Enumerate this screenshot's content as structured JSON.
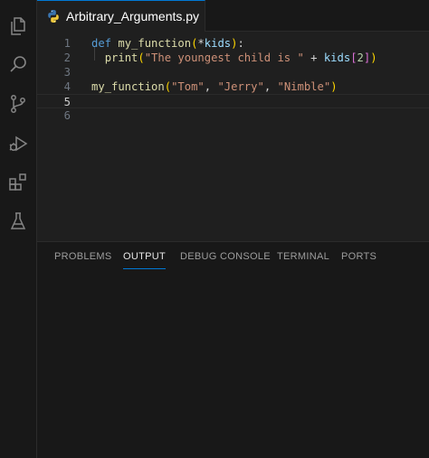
{
  "tab": {
    "filename": "Arbitrary_Arguments.py"
  },
  "activity_bar": [
    "explorer-icon",
    "search-icon",
    "source-control-icon",
    "run-debug-icon",
    "extensions-icon",
    "testing-icon"
  ],
  "editor": {
    "current_line": 5,
    "lines": [
      {
        "number": "1",
        "tokens": [
          {
            "t": "def",
            "c": "kw"
          },
          {
            "t": " ",
            "c": "op"
          },
          {
            "t": "my_function",
            "c": "fn"
          },
          {
            "t": "(",
            "c": "br1"
          },
          {
            "t": "*",
            "c": "op"
          },
          {
            "t": "kids",
            "c": "var"
          },
          {
            "t": ")",
            "c": "br1"
          },
          {
            "t": ":",
            "c": "op"
          }
        ]
      },
      {
        "number": "2",
        "tokens": [
          {
            "t": "  ",
            "c": "op"
          },
          {
            "t": "print",
            "c": "fn"
          },
          {
            "t": "(",
            "c": "br1"
          },
          {
            "t": "\"The youngest child is \"",
            "c": "str"
          },
          {
            "t": " + ",
            "c": "op"
          },
          {
            "t": "kids",
            "c": "var"
          },
          {
            "t": "[",
            "c": "br2"
          },
          {
            "t": "2",
            "c": "num"
          },
          {
            "t": "]",
            "c": "br2"
          },
          {
            "t": ")",
            "c": "br1"
          }
        ]
      },
      {
        "number": "3",
        "tokens": []
      },
      {
        "number": "4",
        "tokens": [
          {
            "t": "my_function",
            "c": "fn"
          },
          {
            "t": "(",
            "c": "br1"
          },
          {
            "t": "\"Tom\"",
            "c": "str"
          },
          {
            "t": ", ",
            "c": "op"
          },
          {
            "t": "\"Jerry\"",
            "c": "str"
          },
          {
            "t": ", ",
            "c": "op"
          },
          {
            "t": "\"Nimble\"",
            "c": "str"
          },
          {
            "t": ")",
            "c": "br1"
          }
        ]
      },
      {
        "number": "5",
        "tokens": []
      },
      {
        "number": "6",
        "tokens": []
      }
    ]
  },
  "panel": {
    "tabs": [
      {
        "label": "PROBLEMS",
        "active": false
      },
      {
        "label": "OUTPUT",
        "active": true
      },
      {
        "label": "DEBUG CONSOLE",
        "active": false
      },
      {
        "label": "TERMINAL",
        "active": false
      },
      {
        "label": "PORTS",
        "active": false
      }
    ]
  }
}
